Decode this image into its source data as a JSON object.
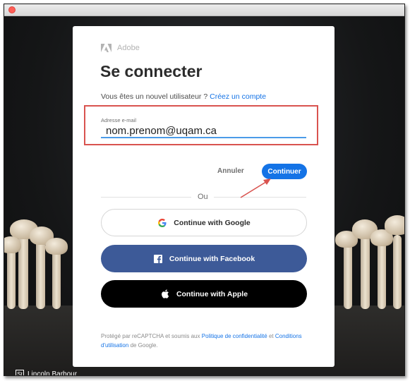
{
  "brand": {
    "logo_icon": "adobe-logo-icon",
    "name": "Adobe"
  },
  "login": {
    "heading": "Se connecter",
    "new_user_text": "Vous êtes un nouvel utilisateur ?",
    "create_account_link": "Créez un compte"
  },
  "email": {
    "label": "Adresse e-mail",
    "value": "nom.prenom@uqam.ca"
  },
  "actions": {
    "cancel_label": "Annuler",
    "continue_label": "Continuer"
  },
  "divider": {
    "label": "Ou"
  },
  "social": {
    "google_label": "Continue with Google",
    "facebook_label": "Continue with Facebook",
    "apple_label": "Continue with Apple"
  },
  "footer": {
    "prefix": "Protégé par reCAPTCHA et soumis aux",
    "privacy_link": "Politique de confidentialité",
    "and": "et",
    "terms_link": "Conditions d'utilisation",
    "suffix": "de Google."
  },
  "photo_credit": {
    "icon": "St",
    "name": "Lincoln Barbour"
  },
  "colors": {
    "accent": "#1473e6",
    "facebook": "#3d5a98",
    "apple": "#000000",
    "annotation": "#d9534f"
  }
}
